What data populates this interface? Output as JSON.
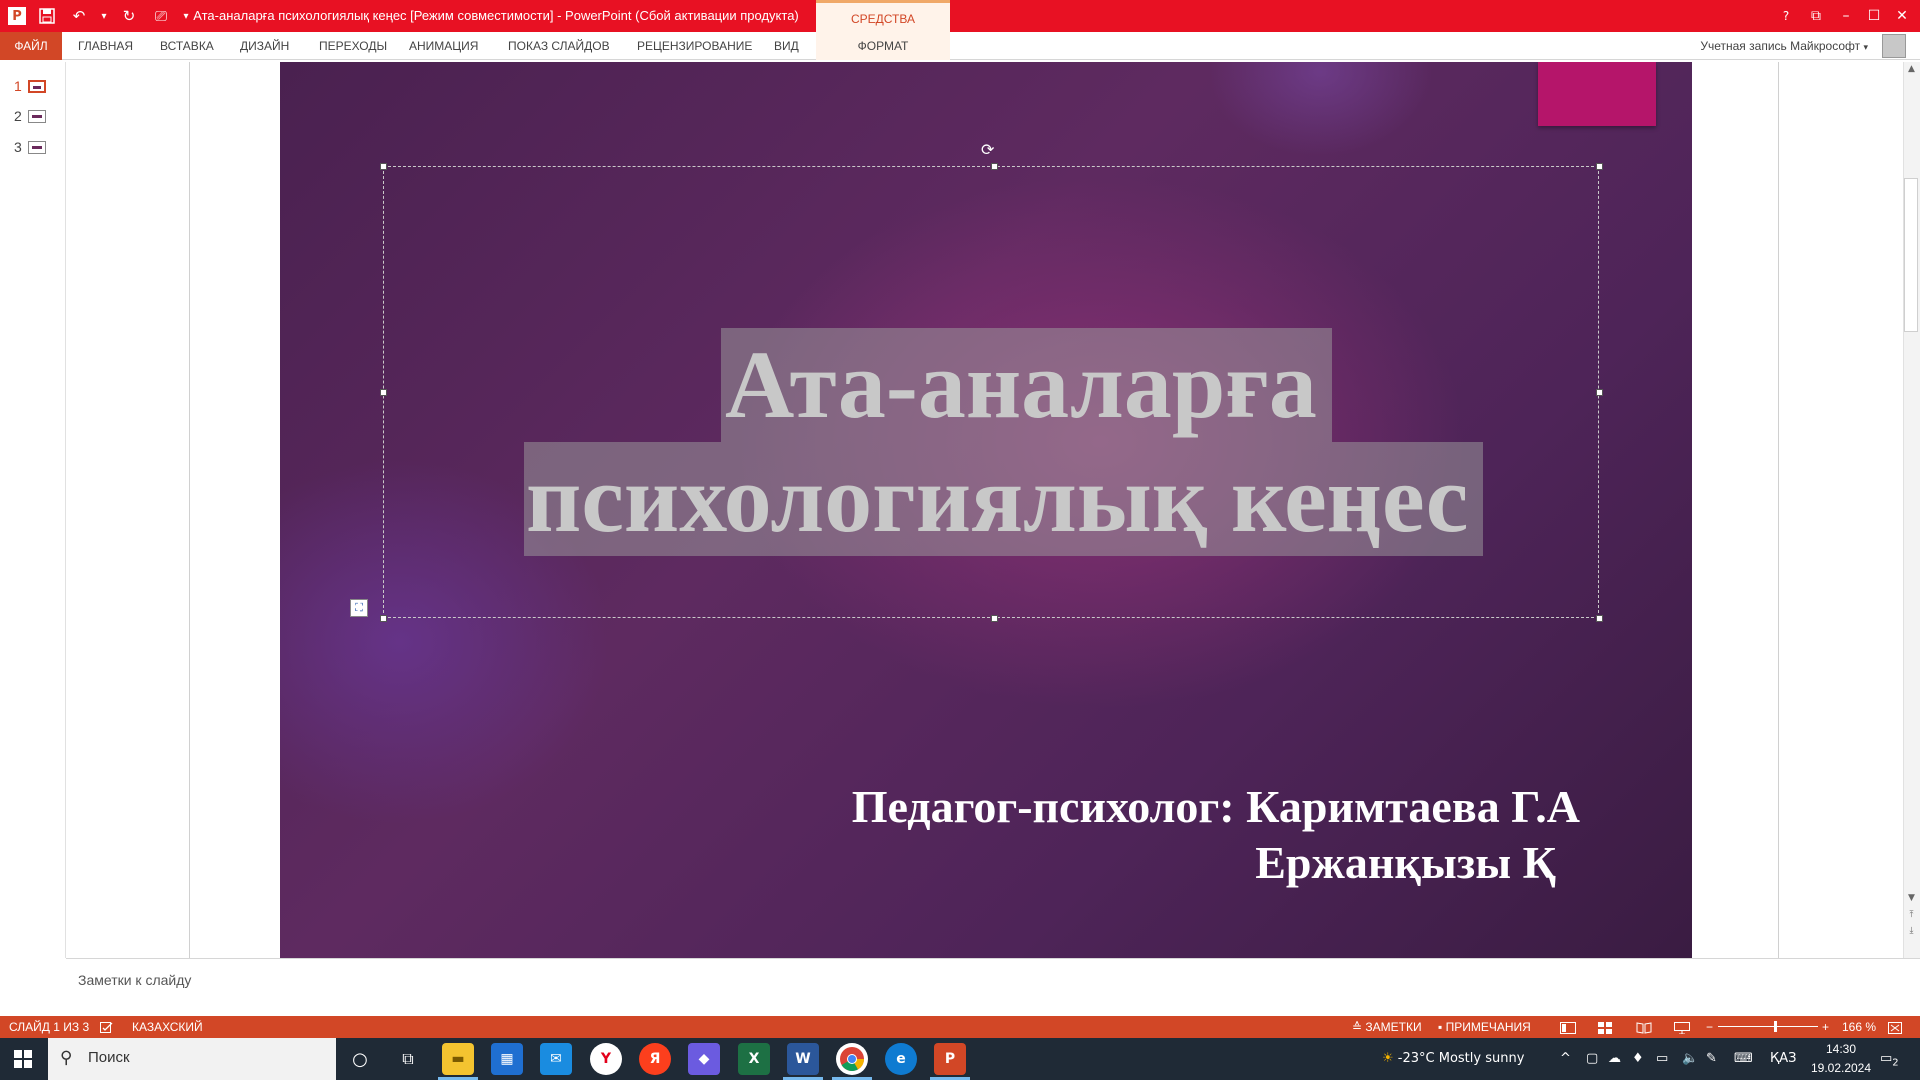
{
  "window": {
    "title": "Ата-аналарға психологиялық кеңес [Режим совместимости] -  PowerPoint (Сбой активации продукта)",
    "contextual_tab_group": "СРЕДСТВА РИСОВАНИЯ",
    "help": "?",
    "ribbon_display": "⧉",
    "minimize": "–",
    "maximize": "☐",
    "close": "✕"
  },
  "quick_access": {
    "app_icon": "P",
    "save": "💾",
    "undo": "↶",
    "undo_dd": "▾",
    "redo": "↻",
    "present": "⎚",
    "customize": "▾"
  },
  "ribbon": {
    "file": "ФАЙЛ",
    "tabs": [
      "ГЛАВНАЯ",
      "ВСТАВКА",
      "ДИЗАЙН",
      "ПЕРЕХОДЫ",
      "АНИМАЦИЯ",
      "ПОКАЗ СЛАЙДОВ",
      "РЕЦЕНЗИРОВАНИЕ",
      "ВИД"
    ],
    "contextual_tab": "ФОРМАТ",
    "account": "Учетная запись Майкрософт",
    "account_dd": "▾"
  },
  "thumbnails": [
    "1",
    "2",
    "3"
  ],
  "slide": {
    "title_line1": "Ата-аналарға",
    "title_line2": "психологиялық кеңес",
    "author_line1": "Педагог-психолог: Каримтаева Г.А",
    "author_line2": "Ержанқызы Қ",
    "rotate_glyph": "⟳",
    "layout_glyph": "⛶"
  },
  "scroll": {
    "up": "▲",
    "down": "▼",
    "prev_slide": "⤒",
    "next_slide": "⤓"
  },
  "notes": {
    "placeholder": "Заметки к слайду"
  },
  "status": {
    "slide_info": "СЛАЙД 1 ИЗ 3",
    "language": "КАЗАХСКИЙ",
    "notes_btn": "ЗАМЕТКИ",
    "comments_btn": "ПРИМЕЧАНИЯ",
    "zoom_minus": "−",
    "zoom_plus": "+",
    "zoom": "166 %",
    "zoom_level_percent": 166
  },
  "taskbar": {
    "search_placeholder": "Поиск",
    "apps": [
      "cortana",
      "task-view",
      "file-explorer",
      "microsoft-store",
      "mail",
      "yandex-browser",
      "yandex",
      "copilot",
      "excel",
      "word",
      "chrome",
      "edge",
      "powerpoint"
    ],
    "weather": "-23°C  Mostly sunny",
    "language": "ҚАЗ",
    "time": "14:30",
    "date": "19.02.2024",
    "notifications": "2"
  },
  "colors": {
    "accent": "#d24726",
    "titlebar": "#e81123",
    "slide_pink": "#b5156a",
    "taskbar": "#1f2a36"
  }
}
